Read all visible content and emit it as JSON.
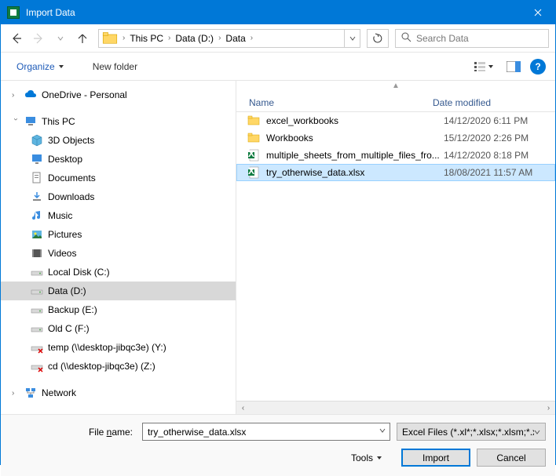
{
  "titlebar": {
    "title": "Import Data"
  },
  "breadcrumb": {
    "items": [
      "This PC",
      "Data (D:)",
      "Data"
    ]
  },
  "search": {
    "placeholder": "Search Data"
  },
  "toolbar": {
    "organize": "Organize",
    "new_folder": "New folder"
  },
  "tree": {
    "onedrive": "OneDrive - Personal",
    "this_pc": "This PC",
    "items": [
      "3D Objects",
      "Desktop",
      "Documents",
      "Downloads",
      "Music",
      "Pictures",
      "Videos",
      "Local Disk (C:)",
      "Data (D:)",
      "Backup (E:)",
      "Old C (F:)",
      "temp (\\\\desktop-jibqc3e) (Y:)",
      "cd (\\\\desktop-jibqc3e) (Z:)"
    ],
    "network": "Network"
  },
  "columns": {
    "name": "Name",
    "date": "Date modified"
  },
  "files": [
    {
      "icon": "folder",
      "name": "excel_workbooks",
      "date": "14/12/2020 6:11 PM"
    },
    {
      "icon": "folder",
      "name": "Workbooks",
      "date": "15/12/2020 2:26 PM"
    },
    {
      "icon": "excel",
      "name": "multiple_sheets_from_multiple_files_fro...",
      "date": "14/12/2020 8:18 PM"
    },
    {
      "icon": "excel",
      "name": "try_otherwise_data.xlsx",
      "date": "18/08/2021 11:57 AM",
      "selected": true
    }
  ],
  "footer": {
    "filename_label": "File name:",
    "filename_value": "try_otherwise_data.xlsx",
    "filter": "Excel Files (*.xl*;*.xlsx;*.xlsm;*.x",
    "tools": "Tools",
    "import": "Import",
    "cancel": "Cancel"
  }
}
